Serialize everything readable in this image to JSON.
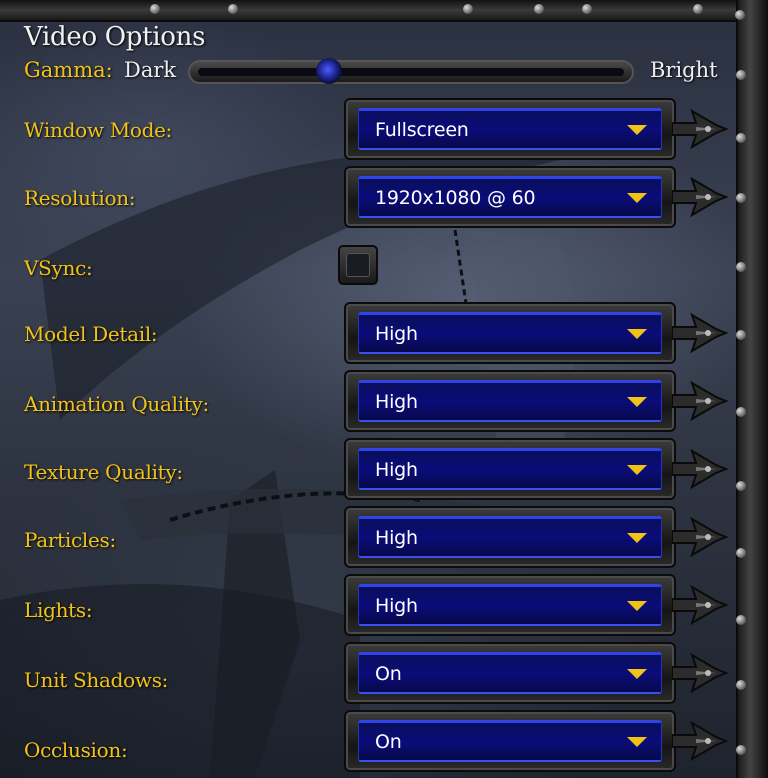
{
  "title": "Video Options",
  "gamma": {
    "label": "Gamma:",
    "dark_label": "Dark",
    "bright_label": "Bright",
    "level": 0.31
  },
  "settings": [
    {
      "label": "Window Mode:",
      "value": "Fullscreen"
    },
    {
      "label": "Resolution:",
      "value": "1920x1080 @ 60"
    },
    {
      "label": "VSync:",
      "checked": false
    },
    {
      "label": "Model Detail:",
      "value": "High"
    },
    {
      "label": "Animation Quality:",
      "value": "High"
    },
    {
      "label": "Texture Quality:",
      "value": "High"
    },
    {
      "label": "Particles:",
      "value": "High"
    },
    {
      "label": "Lights:",
      "value": "High"
    },
    {
      "label": "Unit Shadows:",
      "value": "On"
    },
    {
      "label": "Occlusion:",
      "value": "On"
    }
  ],
  "colors": {
    "label": "#f2c316",
    "dropdown_fill": "#0a0c7a",
    "dropdown_highlight": "#2f44e8",
    "arrow": "#f2c316"
  },
  "icons": {
    "dropdown_arrow": "triangle-down-icon",
    "row_flourish": "spiked-arrow-icon"
  }
}
